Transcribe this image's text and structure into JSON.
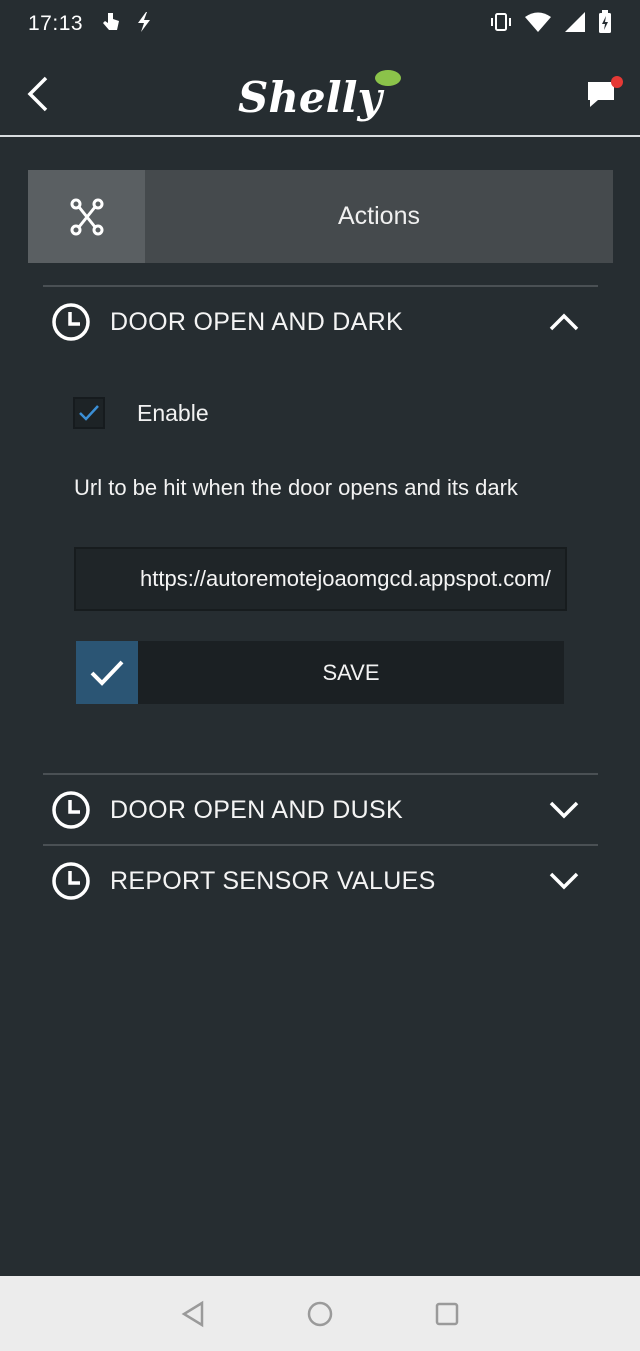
{
  "status_bar": {
    "time": "17:13",
    "icons_left": [
      "touch-icon",
      "bolt-icon"
    ],
    "icons_right": [
      "vibrate-icon",
      "wifi-icon",
      "signal-icon",
      "battery-icon"
    ]
  },
  "header": {
    "brand": "Shelly",
    "back_icon": "chevron-left-icon",
    "chat_icon": "chat-bubble-icon",
    "notification_color": "#e53935"
  },
  "tab": {
    "icon": "actions-network-icon",
    "label": "Actions"
  },
  "sections": [
    {
      "title": "DOOR OPEN AND DARK",
      "expanded": true,
      "enable_label": "Enable",
      "enabled": true,
      "url_label": "Url to be hit when the door opens and its dark",
      "url_value": "https://autoremotejoaomgcd.appspot.com/",
      "save_label": "SAVE"
    },
    {
      "title": "DOOR OPEN AND DUSK",
      "expanded": false
    },
    {
      "title": "REPORT SENSOR VALUES",
      "expanded": false
    }
  ],
  "nav_bar": {
    "icons": [
      "back-triangle-icon",
      "home-circle-icon",
      "recents-square-icon"
    ]
  },
  "colors": {
    "background": "#262d31",
    "accent_blue": "#2b5574",
    "check_blue": "#3b8fd6",
    "brand_green": "#8bc34a"
  }
}
